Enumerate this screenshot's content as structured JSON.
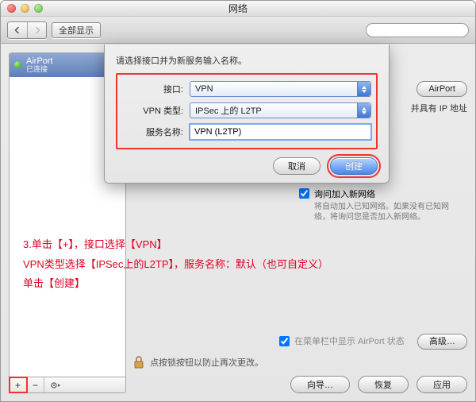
{
  "window": {
    "title": "网络"
  },
  "toolbar": {
    "show_all": "全部显示",
    "search_placeholder": ""
  },
  "sidebar": {
    "items": [
      {
        "name": "AirPort",
        "status": "已连接"
      }
    ]
  },
  "right": {
    "turnoff_label": "AirPort",
    "ip_note": "并具有 IP 地址"
  },
  "askjoin": {
    "label": "询问加入新网络",
    "hint": "将自动加入已知网络。如果没有已知网络，将询问您是否加入新网络。"
  },
  "statusbar": {
    "label": "在菜单栏中显示 AirPort 状态",
    "advanced": "高级…"
  },
  "lock": {
    "label": "点按锁按钮以防止再次更改。"
  },
  "footer": {
    "assist": "向导…",
    "revert": "恢复",
    "apply": "应用"
  },
  "sheet": {
    "prompt": "请选择接口并为新服务输入名称。",
    "labels": {
      "interface": "接口:",
      "vpntype": "VPN 类型:",
      "service": "服务名称:"
    },
    "values": {
      "interface": "VPN",
      "vpntype": "IPSec 上的 L2TP",
      "service": "VPN (L2TP)"
    },
    "cancel": "取消",
    "create": "创建"
  },
  "annotation": {
    "line1": "3.单击【+】，接口选择【VPN】",
    "line2": "VPN类型选择【IPSec上的L2TP】，服务名称：默认（也可自定义）",
    "line3": "单击【创建】"
  }
}
